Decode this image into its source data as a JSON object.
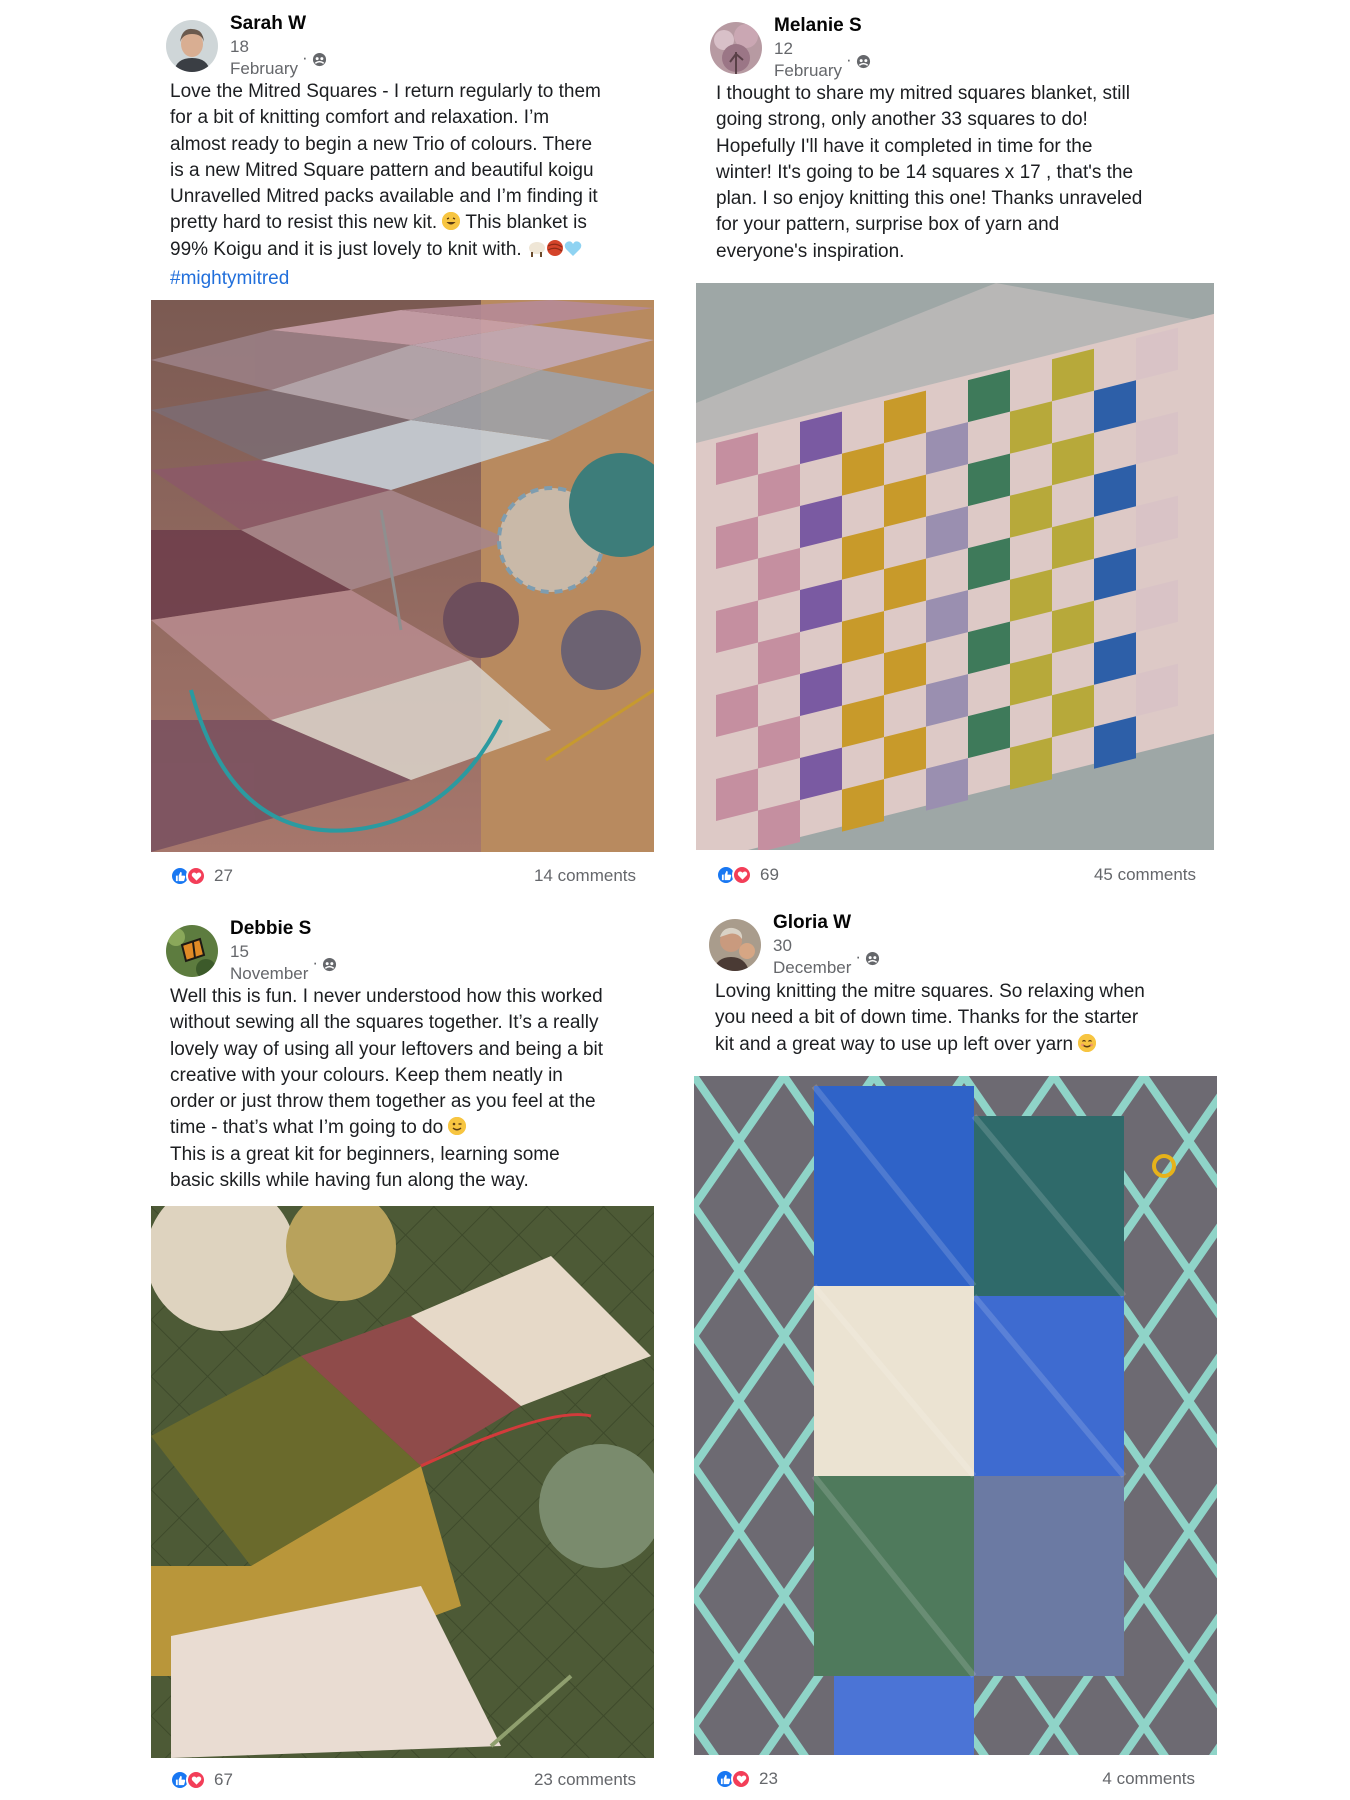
{
  "posts": [
    {
      "author": "Sarah W",
      "date": "18 February",
      "separator": "·",
      "text": "Love the Mitred Squares - I return regularly to them\nfor a bit of knitting comfort and relaxation. I’m\nalmost ready to begin a new Trio of colours.  There\nis a new Mitred Square pattern and beautiful koigu\nUnravelled Mitred packs available and I’m finding it\npretty hard to resist this new kit. ",
      "text_tail": " This blanket is\n99% Koigu and it is just lovely to knit with. ",
      "hashtag": "#mightymitred",
      "reactions": "27",
      "comments": "14 comments"
    },
    {
      "author": "Melanie S",
      "date": "12 February",
      "separator": "·",
      "text": "I thought to share my mitred squares blanket, still\ngoing strong, only another 33 squares to do!\nHopefully I'll have it completed in time for the\nwinter! It's going to be 14 squares x 17 , that's the\nplan. I so enjoy knitting this one! Thanks unraveled\nfor your pattern, surprise box of yarn and\neveryone's inspiration.",
      "reactions": "69",
      "comments": "45 comments"
    },
    {
      "author": "Debbie S",
      "date": "15 November",
      "separator": "·",
      "text": "Well this is fun. I never understood how this worked\nwithout sewing all the squares together. It’s a really\nlovely way of using all your leftovers and being a bit\ncreative with your colours. Keep them neatly in\norder or just throw them together as you feel at the\ntime - that’s what I’m going to do ",
      "text_tail": "\nThis is a great kit for beginners, learning some\nbasic skills while having fun along the way.",
      "reactions": "67",
      "comments": "23 comments"
    },
    {
      "author": "Gloria W",
      "date": "30 December",
      "separator": "·",
      "text": "Loving knitting the mitre squares. So relaxing when\nyou need a bit of down time. Thanks for the starter\nkit and a great way to use up left over yarn ",
      "reactions": "23",
      "comments": "4 comments"
    }
  ],
  "icons": {
    "privacy": "friends-globe-icon",
    "like": "like-reaction-icon",
    "love": "love-reaction-icon"
  },
  "colors": {
    "like": "#1877f2",
    "love": "#f33e58",
    "hashtag": "#216fdb",
    "meta": "#65676b"
  }
}
